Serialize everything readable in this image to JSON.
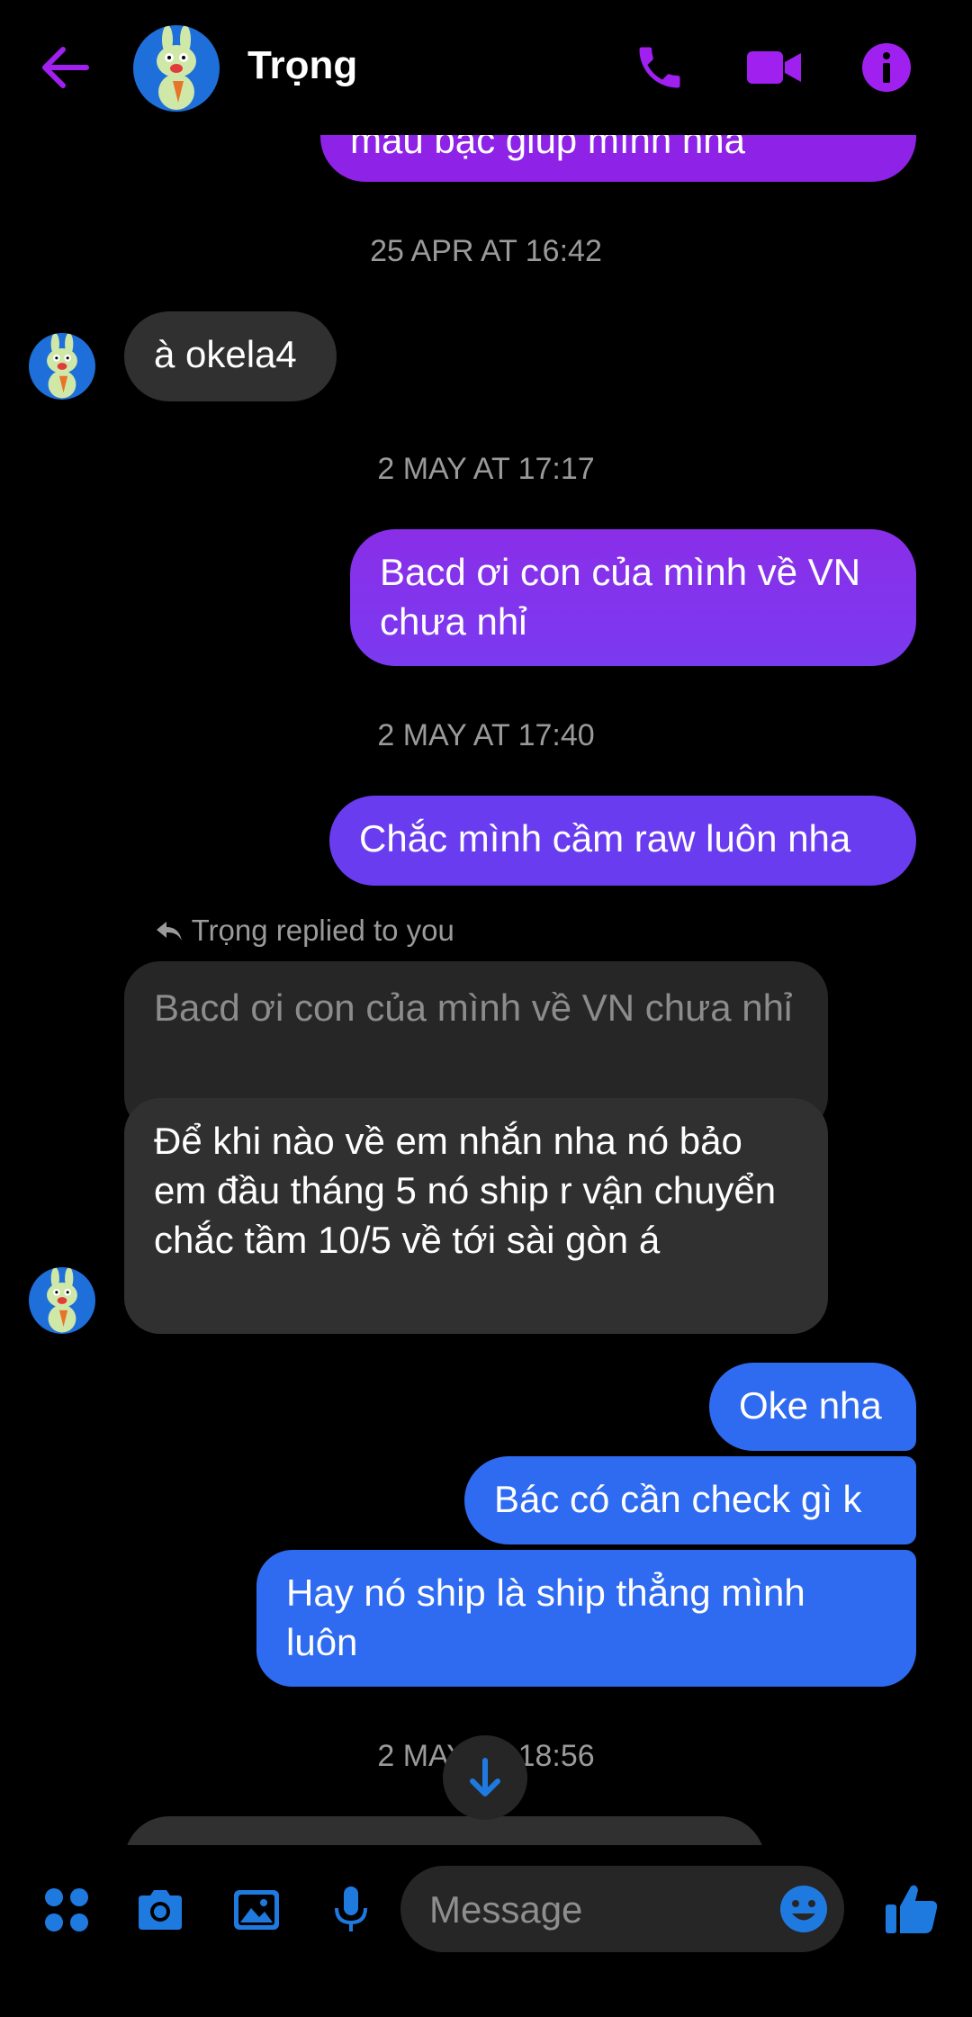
{
  "header": {
    "contact_name": "Trọng",
    "accent_color": "#a020f0",
    "icons": [
      "back-arrow-icon",
      "phone-icon",
      "video-camera-icon",
      "info-icon"
    ]
  },
  "messages": {
    "top_partial": "màu bạc giúp mình nha",
    "ts1": "25 APR AT 16:42",
    "in1": "à okela4",
    "ts2": "2 MAY AT 17:17",
    "out1": "Bacd ơi con của mình về VN chưa nhỉ",
    "ts3": "2 MAY AT 17:40",
    "out2": "Chắc mình cầm raw luôn nha",
    "replied_label": "Trọng replied to you",
    "quoted": "Bacd ơi con của mình về VN chưa nhỉ",
    "in2": "Để khi nào về em nhắn nha nó bảo em đầu tháng 5 nó ship r vận chuyển chắc tầm 10/5 về tới sài gòn á",
    "out3": "Oke nha",
    "out4": "Bác có cần check gì k",
    "out5": "Hay nó ship là ship thẳng mình luôn",
    "ts4": "2 MAY AT 18:56"
  },
  "composer": {
    "placeholder": "Message",
    "icons": [
      "apps-grid-icon",
      "camera-icon",
      "gallery-icon",
      "microphone-icon",
      "emoji-icon",
      "thumbs-up-icon"
    ],
    "accent_color": "#1f7ae0"
  }
}
